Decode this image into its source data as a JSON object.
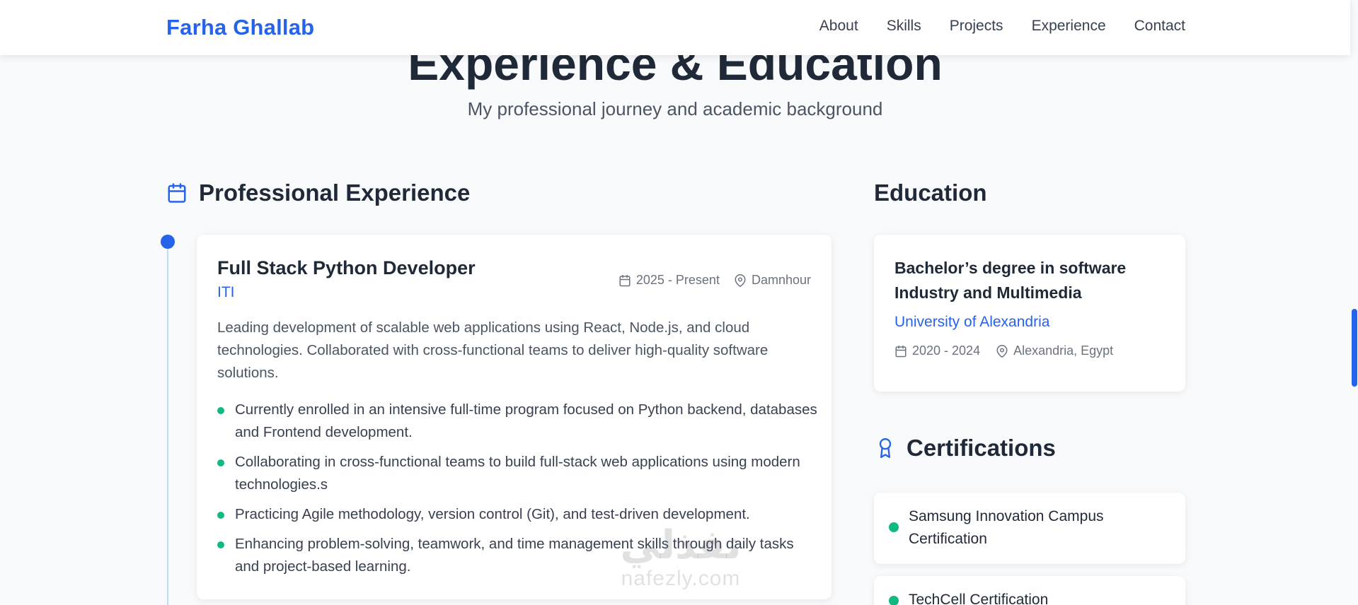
{
  "nav": {
    "brand": "Farha Ghallab",
    "links": [
      "About",
      "Skills",
      "Projects",
      "Experience",
      "Contact"
    ]
  },
  "section": {
    "title": "Experience & Education",
    "subtitle": "My professional journey and academic background"
  },
  "experience": {
    "heading": "Professional Experience",
    "heading_icon": "calendar-icon",
    "jobs": [
      {
        "title": "Full Stack Python Developer",
        "company": "ITI",
        "period": "2025 - Present",
        "location": "Damnhour",
        "description": "Leading development of scalable web applications using React, Node.js, and cloud technologies. Collaborated with cross-functional teams to deliver high-quality software solutions.",
        "bullets": [
          "Currently enrolled in an intensive full-time program focused on Python backend, databases and Frontend development.",
          "Collaborating in cross-functional teams to build full-stack web applications using modern technologies.s",
          "Practicing Agile methodology, version control (Git), and test-driven development.",
          "Enhancing problem-solving, teamwork, and time management skills through daily tasks and project-based learning."
        ]
      }
    ]
  },
  "education": {
    "heading": "Education",
    "items": [
      {
        "degree": "Bachelor’s degree in software Industry and Multimedia",
        "school": "University of Alexandria",
        "period": "2020 - 2024",
        "location": "Alexandria, Egypt"
      }
    ]
  },
  "certifications": {
    "heading": "Certifications",
    "heading_icon": "award-icon",
    "items": [
      "Samsung Innovation Campus Certification",
      "TechCell Certification"
    ]
  },
  "watermark": {
    "arabic": "نفذلي",
    "latin": "nafezly.com"
  },
  "colors": {
    "accent": "#2563eb",
    "bullet": "#10b981",
    "background": "#f8fafc"
  }
}
